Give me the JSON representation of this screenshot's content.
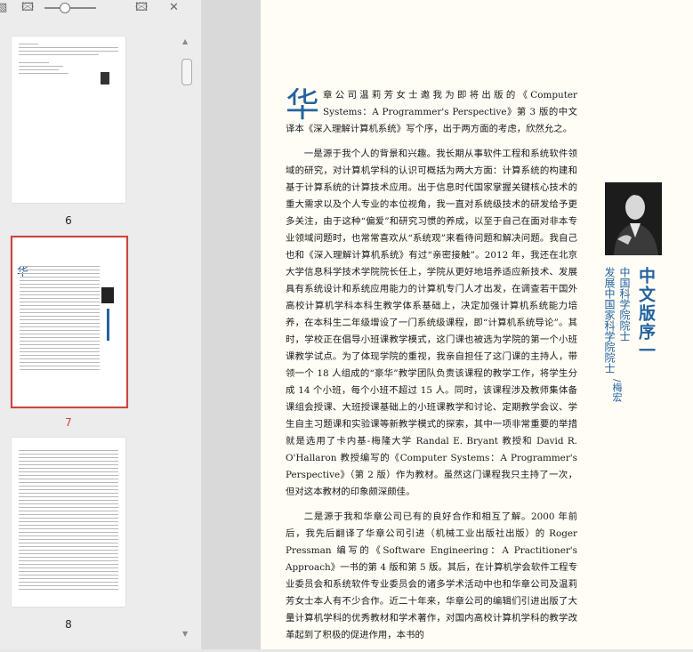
{
  "thumbnails": {
    "pages": [
      {
        "number": "6",
        "selected": false
      },
      {
        "number": "7",
        "selected": true
      },
      {
        "number": "8",
        "selected": false
      }
    ]
  },
  "document": {
    "dropcap": "华",
    "paragraphs": [
      "章公司温莉芳女士邀我为即将出版的《Computer Systems：A Programmer's Perspective》第 3 版的中文译本《深入理解计算机系统》写个序，出于两方面的考虑，欣然允之。",
      "一是源于我个人的背景和兴趣。我长期从事软件工程和系统软件领域的研究，对计算机学科的认识可概括为两大方面：计算系统的构建和基于计算系统的计算技术应用。出于信息时代国家掌握关键核心技术的重大需求以及个人专业的本位视角，我一直对系统级技术的研发给予更多关注，由于这种“偏爱”和研究习惯的养成，以至于自己在面对非本专业领域问题时，也常常喜欢从“系统观”来看待问题和解决问题。我自己也和《深入理解计算机系统》有过“亲密接触”。2012 年，我还在北京大学信息科学技术学院院长任上，学院从更好地培养适应新技术、发展具有系统设计和系统应用能力的计算机专门人才出发，在调查若干国外高校计算机学科本科生教学体系基础上，决定加强计算机系统能力培养，在本科生二年级增设了一门系统级课程，即“计算机系统导论”。其时，学校正在倡导小班课教学模式，这门课也被选为学院的第一个小班课教学试点。为了体现学院的重视，我亲自担任了这门课的主持人，带领一个 18 人组成的“豪华”教学团队负责该课程的教学工作，将学生分成 14 个小班，每个小班不超过 15 人。同时，该课程涉及教师集体备课组会授课、大班授课基础上的小班课教学和讨论、定期教学会议、学生自主习题课和实验课等新教学模式的探索，其中一项非常重要的举措就是选用了卡内基-梅隆大学 Randal E. Bryant 教授和 David R. O'Hallaron 教授编写的《Computer Systems：A Programmer's Perspective》（第 2 版）作为教材。虽然这门课程我只主持了一次，但对这本教材的印象颇深颇佳。",
      "二是源于我和华章公司已有的良好合作和相互了解。2000 年前后，我先后翻译了华章公司引进（机械工业出版社出版）的 Roger Pressman 编写的《Software Engineering：A Practitioner's Approach》一书的第 4 版和第 5 版。其后，在计算机学会软件工程专业委员会和系统软件专业委员会的诸多学术活动中也和华章公司及温莉芳女士本人有不少合作。近二十年来，华章公司的编辑们引进出版了大量计算机学科的优秀教材和学术著作，对国内高校计算机学科的教学改革起到了积极的促进作用，本书的"
    ],
    "sidebar": {
      "title": "中文版序一",
      "affiliation_1": "中国科学院院士",
      "affiliation_2": "发展中国家科学院院士",
      "author": "/梅宏"
    }
  }
}
